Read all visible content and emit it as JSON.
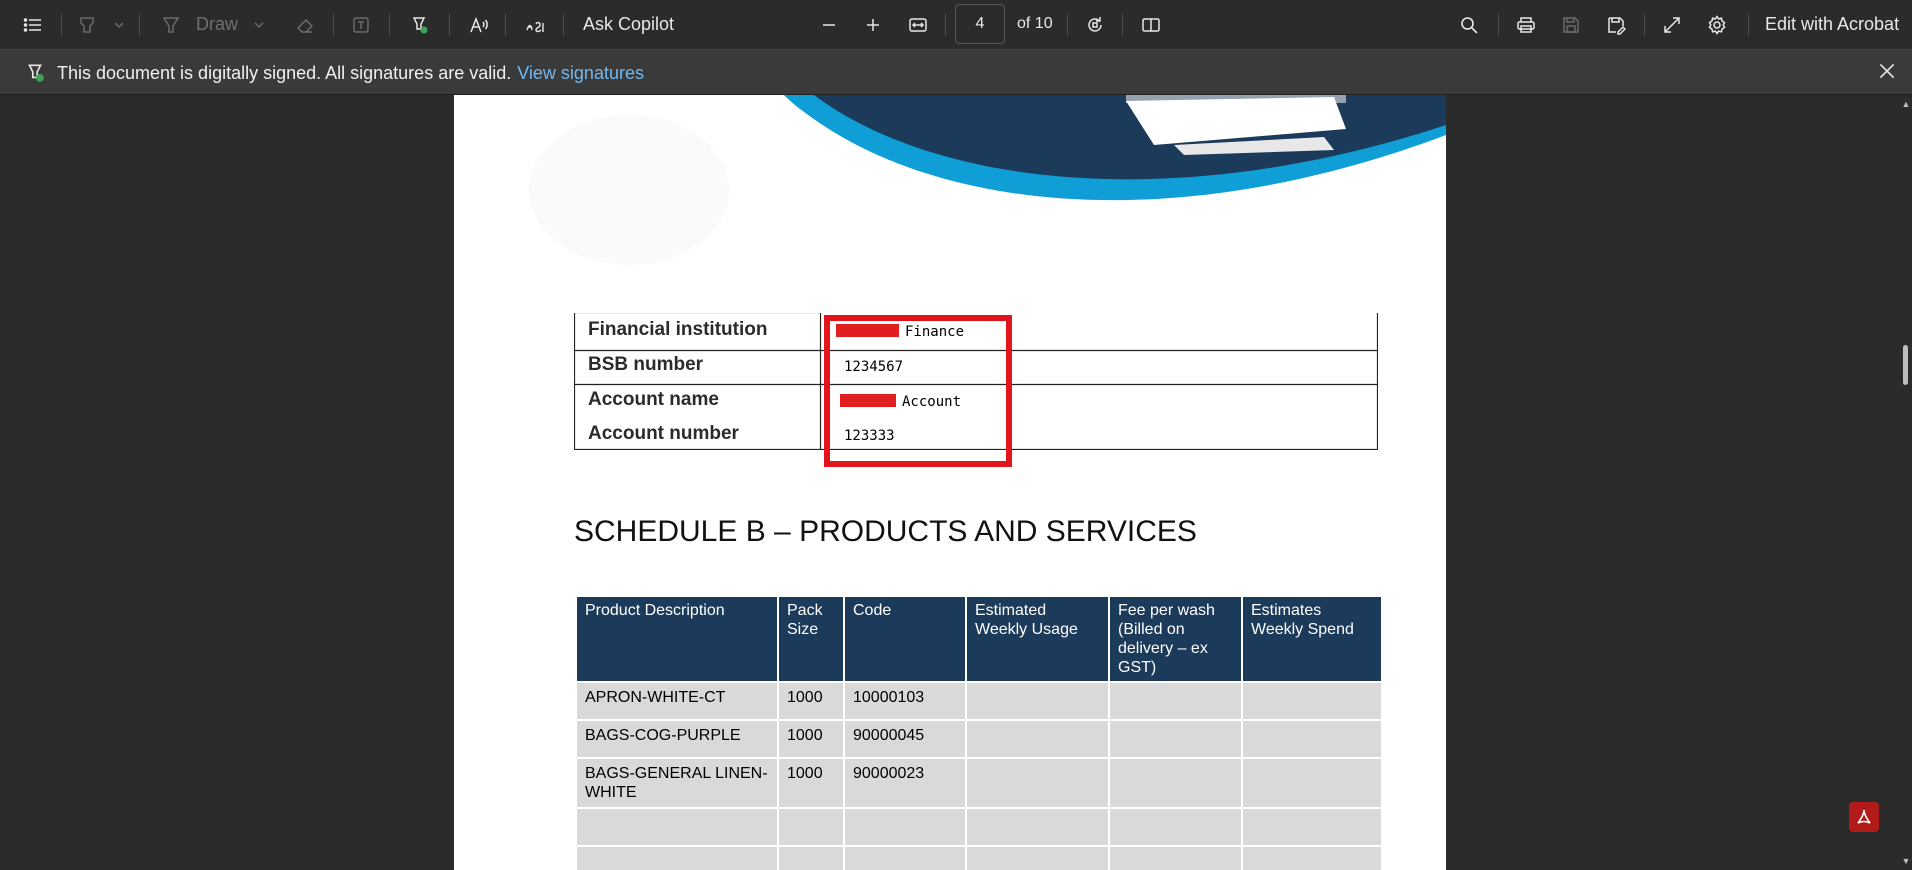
{
  "toolbar": {
    "draw_label": "Draw",
    "ask_copilot_label": "Ask Copilot",
    "page_number": "4",
    "page_total": "of 10",
    "edit_label": "Edit with Acrobat"
  },
  "signature_bar": {
    "message": "This document is digitally signed. All signatures are valid.",
    "link": "View signatures"
  },
  "bank_details": [
    {
      "label": "Financial institution",
      "value": "Finance",
      "redacted": true
    },
    {
      "label": "BSB number",
      "value": "1234567",
      "redacted": false
    },
    {
      "label": "Account name",
      "value": "Account",
      "redacted": true
    },
    {
      "label": "Account number",
      "value": "123333",
      "redacted": false
    }
  ],
  "schedule_title": "SCHEDULE B – PRODUCTS AND SERVICES",
  "products_table": {
    "headers": [
      "Product Description",
      "Pack Size",
      "Code",
      "Estimated Weekly Usage",
      "Fee per wash (Billed on delivery – ex GST)",
      "Estimates Weekly Spend"
    ],
    "rows": [
      [
        "APRON-WHITE-CT",
        "1000",
        "10000103",
        "",
        "",
        ""
      ],
      [
        "BAGS-COG-PURPLE",
        "1000",
        "90000045",
        "",
        "",
        ""
      ],
      [
        "BAGS-GENERAL LINEN-WHITE",
        "1000",
        "90000023",
        "",
        "",
        ""
      ],
      [
        "",
        "",
        "",
        "",
        "",
        ""
      ],
      [
        "",
        "",
        "",
        "",
        "",
        ""
      ]
    ]
  },
  "colors": {
    "toolbar_bg": "#2b2b2b",
    "table_header_bg": "#1c3a5a",
    "table_cell_bg": "#d9d9d9",
    "highlight_red": "#e3141e",
    "link_blue": "#6fb8f2"
  },
  "icons": [
    "list-icon",
    "highlighter-icon",
    "draw-icon",
    "eraser-icon",
    "text-box-icon",
    "signature-icon",
    "read-aloud-icon",
    "translate-icon",
    "zoom-out-icon",
    "zoom-in-icon",
    "fit-width-icon",
    "rotate-icon",
    "page-view-icon",
    "search-icon",
    "print-icon",
    "save-icon",
    "save-as-icon",
    "fullscreen-icon",
    "settings-icon",
    "close-icon",
    "acrobat-icon"
  ]
}
